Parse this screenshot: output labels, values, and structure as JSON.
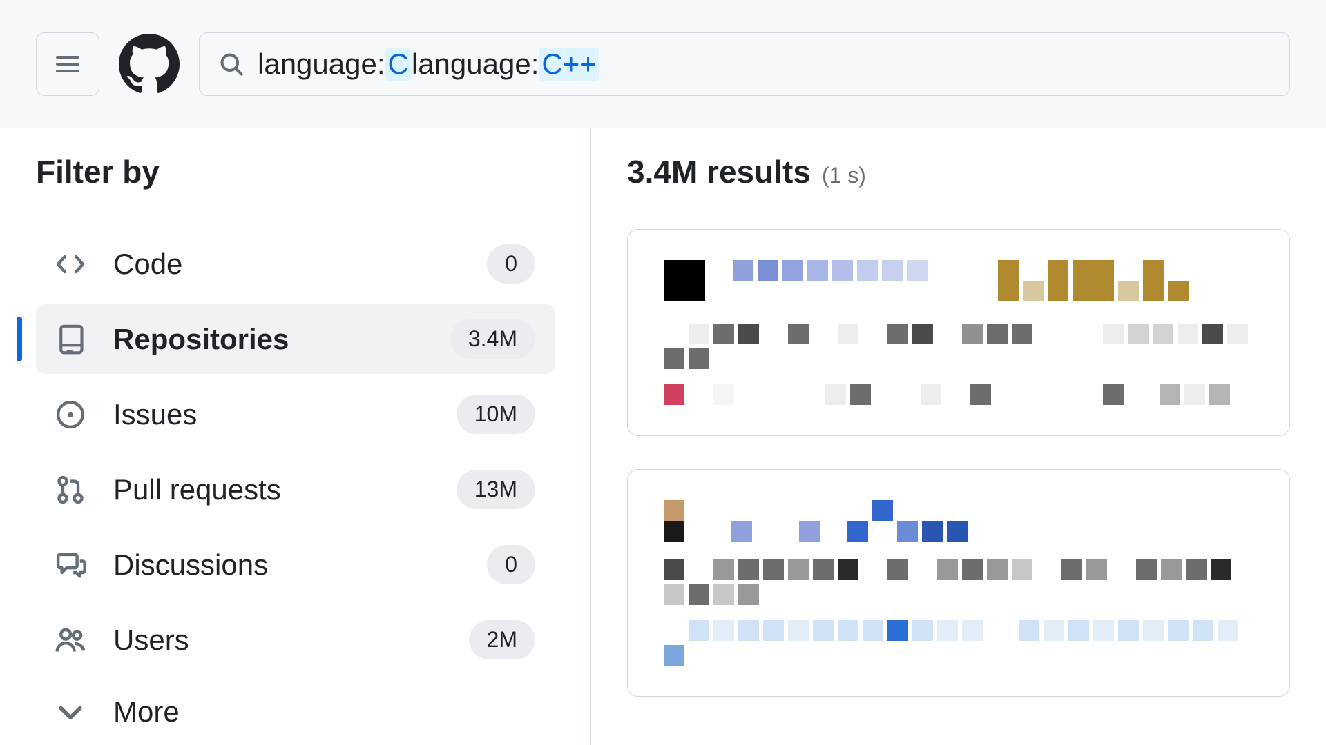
{
  "search": {
    "prefix1": "language:",
    "value1": "C",
    "space": " ",
    "prefix2": "language:",
    "value2": "C++"
  },
  "sidebar": {
    "title": "Filter by",
    "items": [
      {
        "label": "Code",
        "count": "0"
      },
      {
        "label": "Repositories",
        "count": "3.4M"
      },
      {
        "label": "Issues",
        "count": "10M"
      },
      {
        "label": "Pull requests",
        "count": "13M"
      },
      {
        "label": "Discussions",
        "count": "0"
      },
      {
        "label": "Users",
        "count": "2M"
      },
      {
        "label": "More",
        "count": ""
      }
    ]
  },
  "results": {
    "count": "3.4M results",
    "time": "(1 s)"
  }
}
